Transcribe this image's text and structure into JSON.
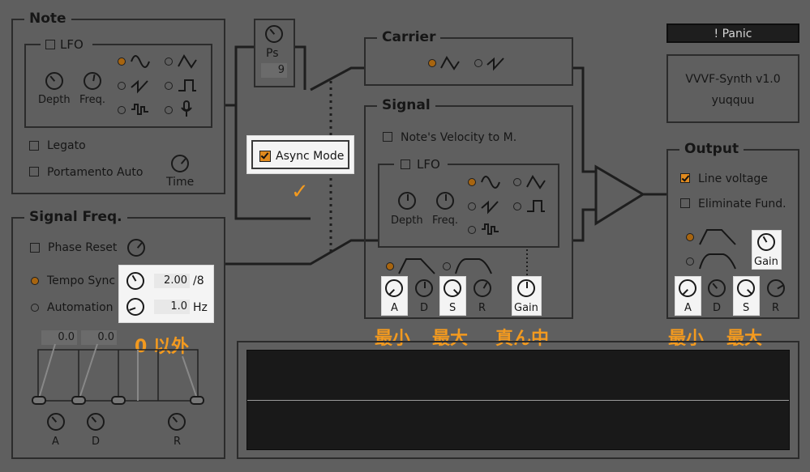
{
  "colors": {
    "background": "#5f5f5f",
    "accent": "#e08a1e",
    "annotation": "#f39a1f",
    "line": "#2b2b2b"
  },
  "note": {
    "title": "Note",
    "lfo_label": "LFO",
    "depth_label": "Depth",
    "freq_label": "Freq.",
    "waveforms": [
      "sine",
      "triangle",
      "saw",
      "square",
      "random-steps",
      "microphone"
    ],
    "selected_waveform": "sine",
    "legato_label": "Legato",
    "portamento_label": "Portamento Auto",
    "time_label": "Time"
  },
  "ps": {
    "label": "Ps",
    "value": "9"
  },
  "async": {
    "label": "Async Mode",
    "checked": true,
    "annotation": "✓"
  },
  "carrier": {
    "title": "Carrier",
    "selected_waveform": "triangle"
  },
  "signal": {
    "title": "Signal",
    "velocity_label": "Note's Velocity to M.",
    "lfo_label": "LFO",
    "depth_label": "Depth",
    "freq_label": "Freq.",
    "adsr_labels": [
      "A",
      "D",
      "S",
      "R"
    ],
    "gain_label": "Gain"
  },
  "signal_freq": {
    "title": "Signal Freq.",
    "phase_reset_label": "Phase Reset",
    "tempo_sync_label": "Tempo Sync",
    "tempo_value": "2.00",
    "tempo_unit": "/8",
    "automation_label": "Automation",
    "automation_value": "1.0",
    "automation_unit": "Hz",
    "env_value_1": "0.0",
    "env_value_2": "0.0",
    "env_labels": [
      "A",
      "D",
      "R"
    ]
  },
  "panic": {
    "label": "! Panic"
  },
  "about": {
    "name": "VVVF-Synth v1.0",
    "author": "yuqquu"
  },
  "output": {
    "title": "Output",
    "line_voltage_label": "Line voltage",
    "line_voltage_checked": true,
    "eliminate_label": "Eliminate Fund.",
    "gain_label": "Gain",
    "adsr_labels": [
      "A",
      "D",
      "S",
      "R"
    ]
  },
  "annotations": {
    "signal_a": "最小",
    "signal_s": "最大",
    "signal_gain": "真ん中",
    "freq_nonzero": "0 以外",
    "output_a": "最小",
    "output_s": "最大"
  }
}
